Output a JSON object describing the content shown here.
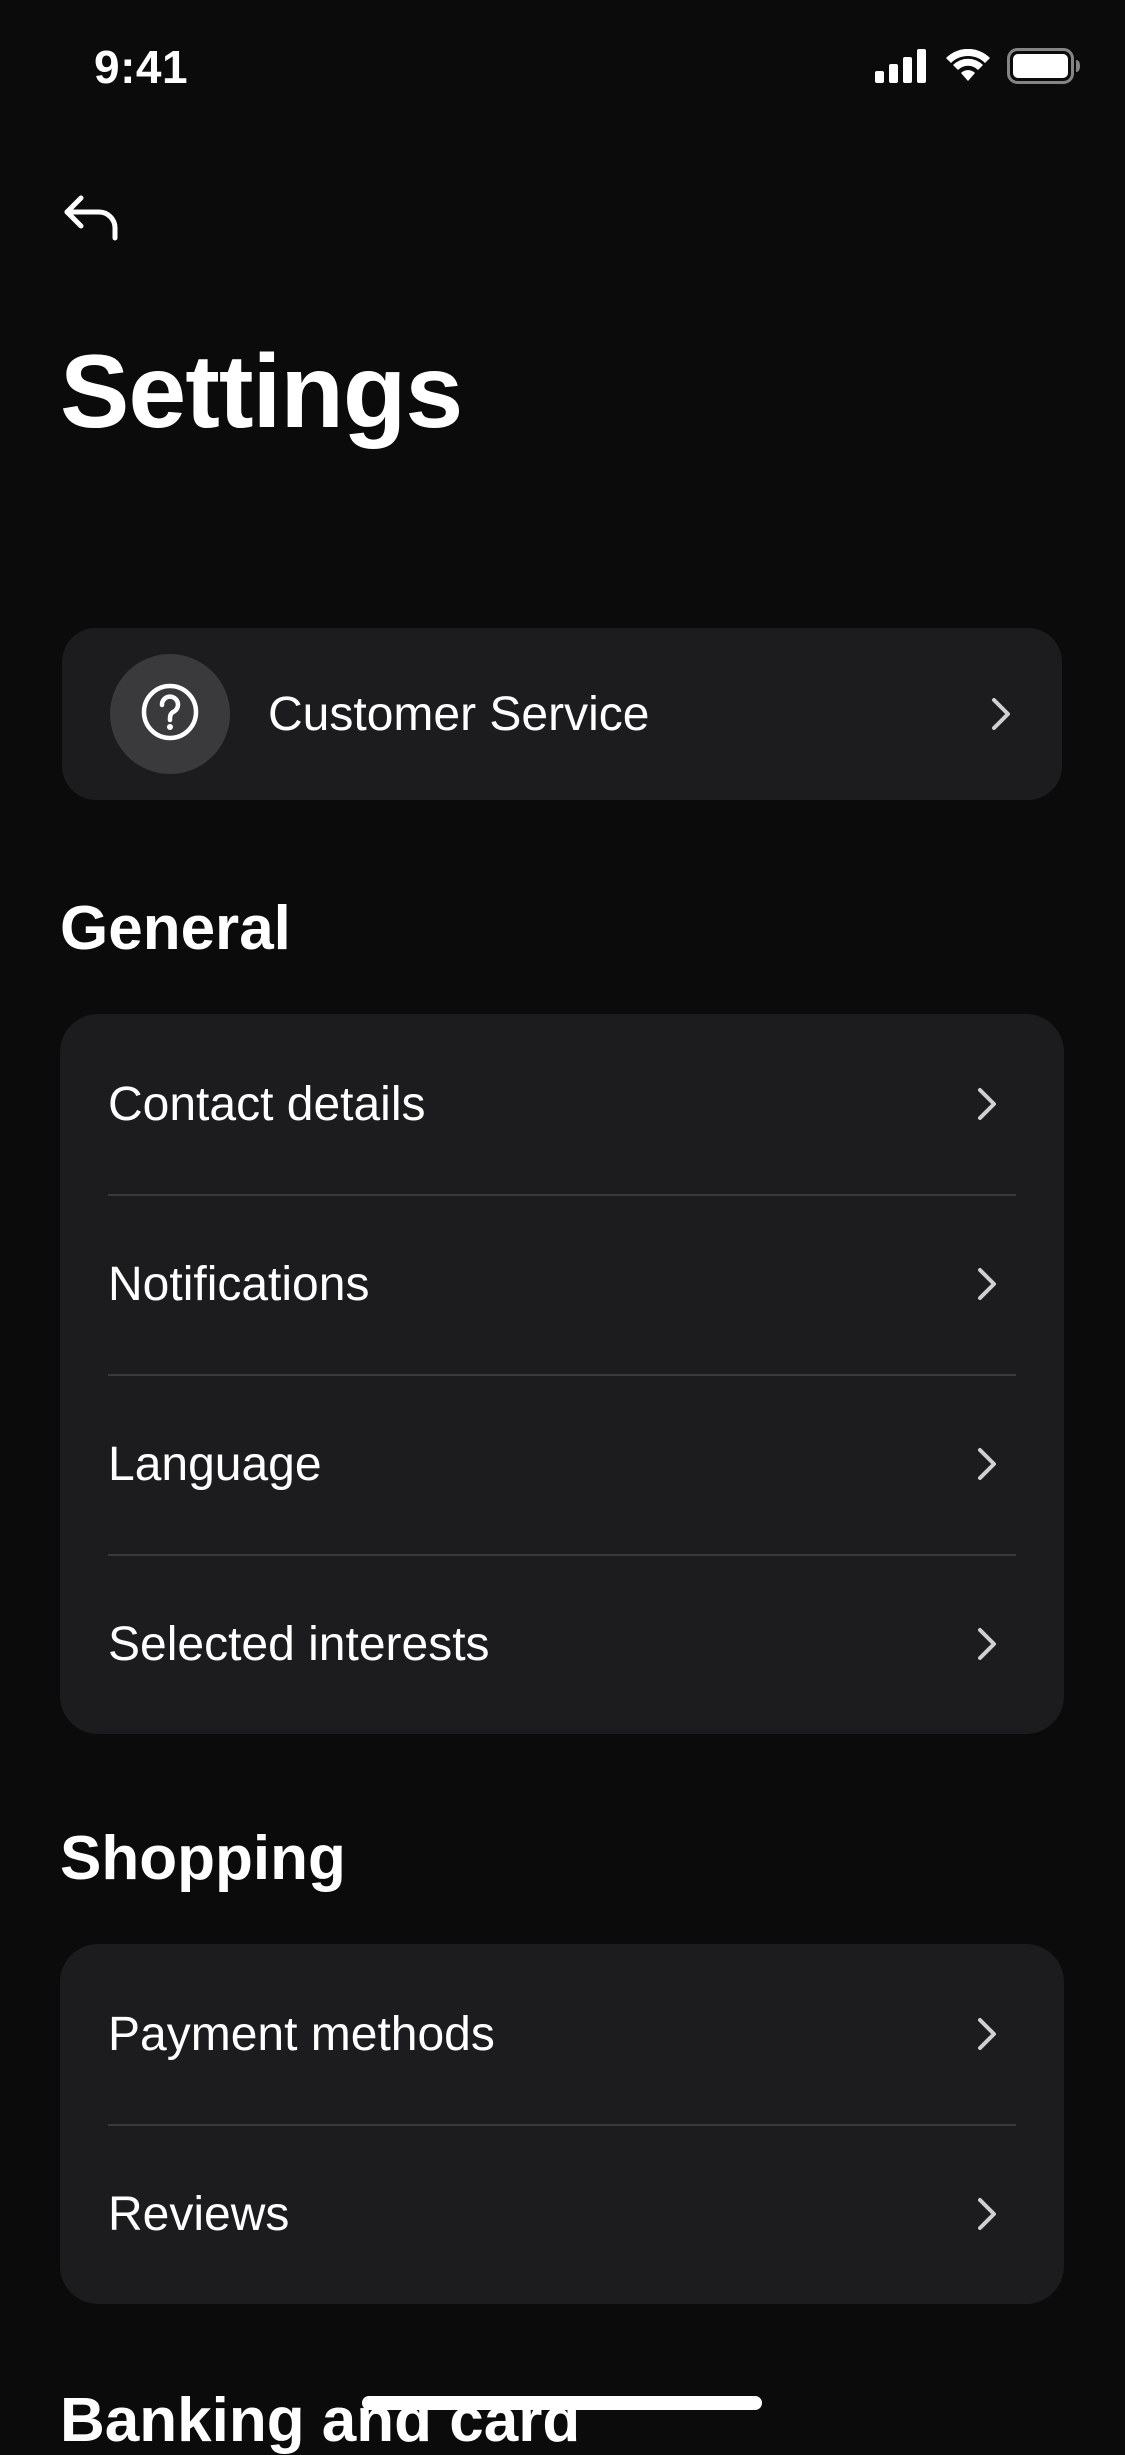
{
  "status_bar": {
    "time": "9:41",
    "icons": [
      "signal-icon",
      "wifi-icon",
      "battery-icon"
    ]
  },
  "header": {
    "back_icon": "back-arrow-icon",
    "title": "Settings"
  },
  "customer_service": {
    "icon": "help-circle-icon",
    "label": "Customer Service"
  },
  "sections": [
    {
      "title": "General",
      "items": [
        {
          "label": "Contact details"
        },
        {
          "label": "Notifications"
        },
        {
          "label": "Language"
        },
        {
          "label": "Selected interests"
        }
      ]
    },
    {
      "title": "Shopping",
      "items": [
        {
          "label": "Payment methods"
        },
        {
          "label": "Reviews"
        }
      ]
    },
    {
      "title": "Banking and card",
      "items": []
    }
  ],
  "colors": {
    "background": "#0b0b0b",
    "card": "#1c1c1e",
    "icon_circle": "#3a3a3c",
    "divider": "#3a3a3c",
    "text": "#ffffff"
  }
}
